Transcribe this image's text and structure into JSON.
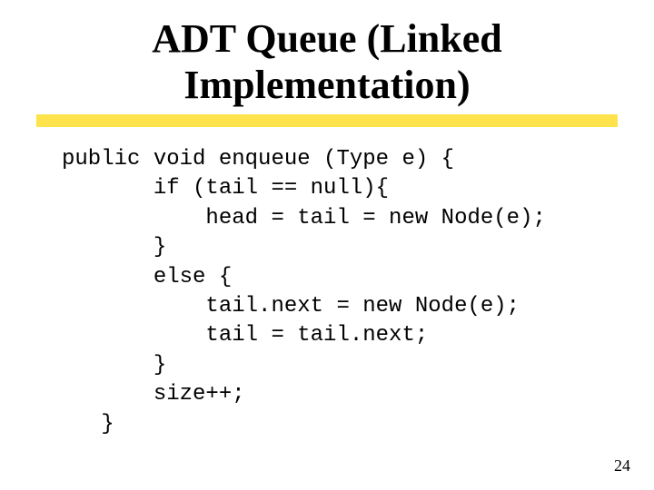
{
  "title": {
    "line1": "ADT Queue (Linked",
    "line2": "Implementation)"
  },
  "code": {
    "l1": "public void enqueue (Type e) {",
    "l2": "       if (tail == null){",
    "l3": "           head = tail = new Node(e);",
    "l4": "       }",
    "l5": "       else {",
    "l6": "           tail.next = new Node(e);",
    "l7": "           tail = tail.next;",
    "l8": "       }",
    "l9": "       size++;",
    "l10": "   }"
  },
  "page_number": "24"
}
